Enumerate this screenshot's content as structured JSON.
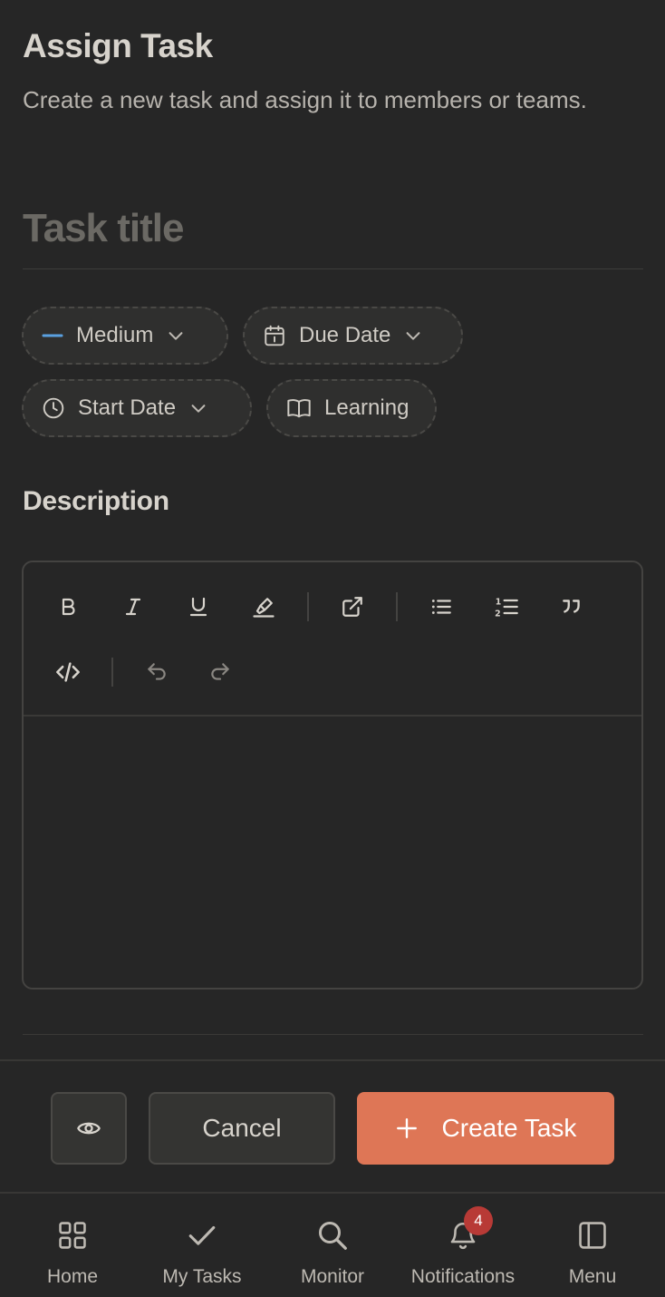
{
  "header": {
    "title": "Assign Task",
    "subtitle": "Create a new task and assign it to members or teams."
  },
  "form": {
    "task_title_placeholder": "Task title",
    "task_title_value": ""
  },
  "chips": {
    "priority": "Medium",
    "due_date": "Due Date",
    "start_date": "Start Date",
    "category": "Learning"
  },
  "colors": {
    "priority_medium": "#5aa0e0",
    "accent": "#de7656",
    "badge": "#b83a36"
  },
  "description": {
    "label": "Description",
    "content": ""
  },
  "toolbar": {
    "icons": [
      "bold-icon",
      "italic-icon",
      "underline-icon",
      "highlight-icon",
      "link-icon",
      "bullet-list-icon",
      "ordered-list-icon",
      "quote-icon",
      "code-icon",
      "undo-icon",
      "redo-icon"
    ]
  },
  "actions": {
    "cancel_label": "Cancel",
    "create_label": "Create Task"
  },
  "nav": {
    "items": [
      {
        "label": "Home",
        "icon": "home-grid-icon"
      },
      {
        "label": "My Tasks",
        "icon": "check-icon"
      },
      {
        "label": "Monitor",
        "icon": "search-icon"
      },
      {
        "label": "Notifications",
        "icon": "bell-icon",
        "badge": "4"
      },
      {
        "label": "Menu",
        "icon": "sidebar-panel-icon"
      }
    ]
  }
}
